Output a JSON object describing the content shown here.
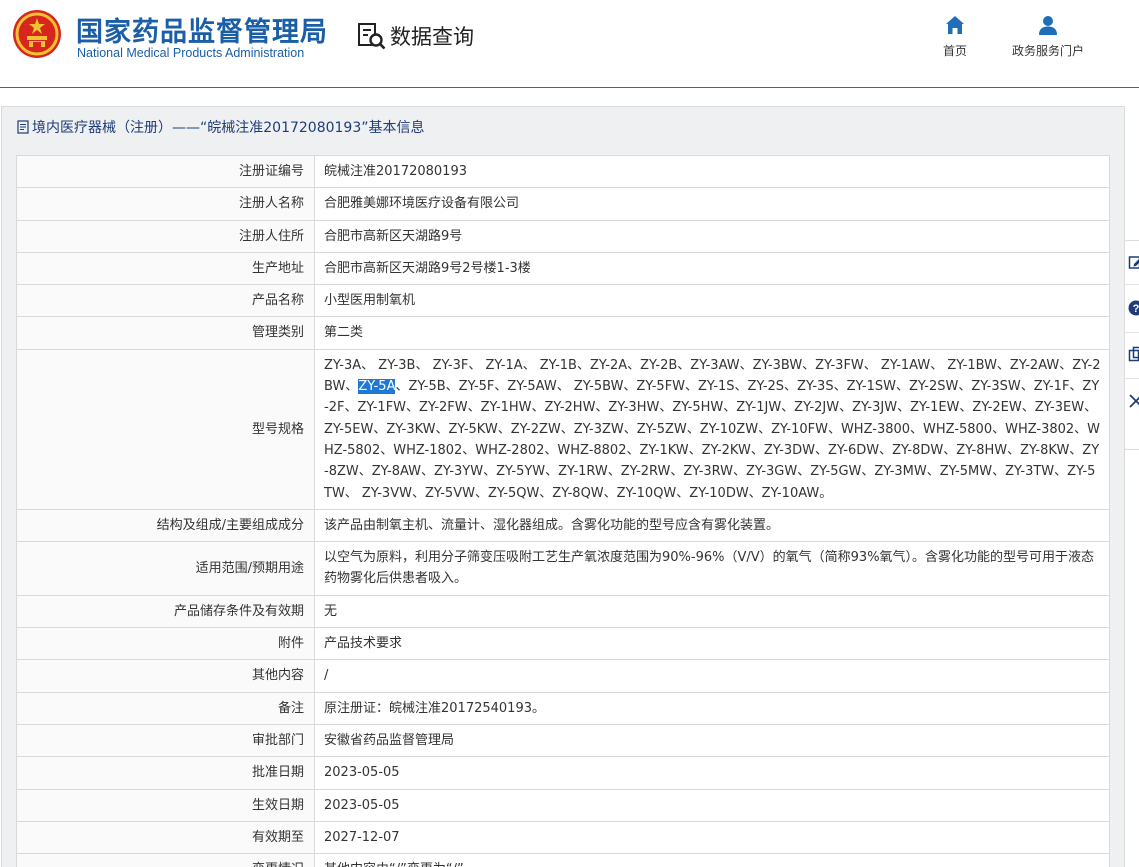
{
  "header": {
    "brand_cn": "国家药品监督管理局",
    "brand_en": "National Medical Products Administration",
    "query_title": "数据查询",
    "nav": {
      "home": "首页",
      "portal": "政务服务门户"
    }
  },
  "section": {
    "title": "境内医疗器械（注册）——“皖械注准20172080193”基本信息"
  },
  "details": {
    "rows": [
      {
        "label": "注册证编号",
        "value": "皖械注准20172080193"
      },
      {
        "label": "注册人名称",
        "value": "合肥雅美娜环境医疗设备有限公司"
      },
      {
        "label": "注册人住所",
        "value": "合肥市高新区天湖路9号"
      },
      {
        "label": "生产地址",
        "value": "合肥市高新区天湖路9号2号楼1-3楼"
      },
      {
        "label": "产品名称",
        "value": "小型医用制氧机"
      },
      {
        "label": "管理类别",
        "value": "第二类"
      },
      {
        "label": "型号规格",
        "value_before": "ZY-3A、 ZY-3B、 ZY-3F、 ZY-1A、 ZY-1B、ZY-2A、ZY-2B、ZY-3AW、ZY-3BW、ZY-3FW、 ZY-1AW、 ZY-1BW、ZY-2AW、ZY-2BW、",
        "value_selected": "ZY-5A",
        "value_after": "、ZY-5B、ZY-5F、ZY-5AW、 ZY-5BW、ZY-5FW、ZY-1S、ZY-2S、ZY-3S、ZY-1SW、ZY-2SW、ZY-3SW、ZY-1F、ZY-2F、ZY-1FW、ZY-2FW、ZY-1HW、ZY-2HW、ZY-3HW、ZY-5HW、ZY-1JW、ZY-2JW、ZY-3JW、ZY-1EW、ZY-2EW、ZY-3EW、ZY-5EW、ZY-3KW、ZY-5KW、ZY-2ZW、ZY-3ZW、ZY-5ZW、ZY-10ZW、ZY-10FW、WHZ-3800、WHZ-5800、WHZ-3802、WHZ-5802、WHZ-1802、WHZ-2802、WHZ-8802、ZY-1KW、ZY-2KW、ZY-3DW、ZY-6DW、ZY-8DW、ZY-8HW、ZY-8KW、ZY-8ZW、ZY-8AW、ZY-3YW、ZY-5YW、ZY-1RW、ZY-2RW、ZY-3RW、ZY-3GW、ZY-5GW、ZY-3MW、ZY-5MW、ZY-3TW、ZY-5TW、 ZY-3VW、ZY-5VW、ZY-5QW、ZY-8QW、ZY-10QW、ZY-10DW、ZY-10AW。"
      },
      {
        "label": "结构及组成/主要组成成分",
        "value": "该产品由制氧主机、流量计、湿化器组成。含雾化功能的型号应含有雾化装置。"
      },
      {
        "label": "适用范围/预期用途",
        "value": "以空气为原料，利用分子筛变压吸附工艺生产氧浓度范围为90%-96%（V/V）的氧气（简称93%氧气）。含雾化功能的型号可用于液态药物雾化后供患者吸入。"
      },
      {
        "label": "产品储存条件及有效期",
        "value": "无"
      },
      {
        "label": "附件",
        "value": "产品技术要求"
      },
      {
        "label": "其他内容",
        "value": "/"
      },
      {
        "label": "备注",
        "value": "原注册证：皖械注准20172540193。"
      },
      {
        "label": "审批部门",
        "value": "安徽省药品监督管理局"
      },
      {
        "label": "批准日期",
        "value": "2023-05-05"
      },
      {
        "label": "生效日期",
        "value": "2023-05-05"
      },
      {
        "label": "有效期至",
        "value": "2027-12-07"
      },
      {
        "label": "变更情况",
        "value": "其他内容由“/”变更为“/”"
      }
    ]
  },
  "colors": {
    "brand_blue": "#1a5ea8",
    "nav_icon_blue": "#1f6fb8",
    "selection_blue": "#1e78d6",
    "emblem_red": "#d7261e",
    "emblem_gold": "#f2c230"
  },
  "icons": {
    "emblem": "national-emblem-icon",
    "query": "search-document-icon",
    "home": "home-icon",
    "portal": "user-icon",
    "section": "document-icon",
    "float_bar": [
      "edit-icon",
      "help-icon",
      "copy-icon",
      "close-icon"
    ]
  }
}
